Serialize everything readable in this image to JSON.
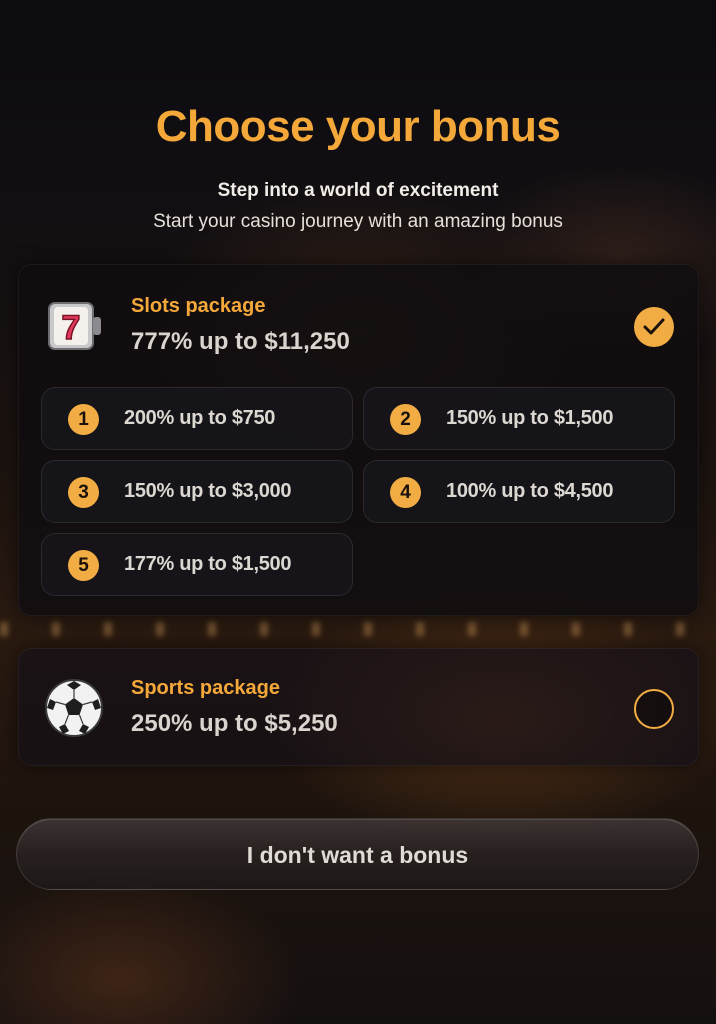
{
  "header": {
    "title": "Choose your bonus",
    "subtitle": "Step into a world of excitement",
    "tagline": "Start your casino journey with an amazing bonus"
  },
  "slots_package": {
    "icon": "slot-machine-777-icon",
    "name": "Slots package",
    "value": "777% up to $11,250",
    "selected": true,
    "options": [
      {
        "number": "1",
        "label": "200% up to $750"
      },
      {
        "number": "2",
        "label": "150% up to $1,500"
      },
      {
        "number": "3",
        "label": "150% up to $3,000"
      },
      {
        "number": "4",
        "label": "100% up to $4,500"
      },
      {
        "number": "5",
        "label": "177% up to $1,500"
      }
    ]
  },
  "sports_package": {
    "icon": "soccer-ball-icon",
    "name": "Sports package",
    "value": "250% up to $5,250",
    "selected": false
  },
  "no_bonus_button": {
    "label": "I don't want a bonus"
  },
  "colors": {
    "accent": "#f5a83a",
    "check": "#f2ac44",
    "text": "#dcd7d1"
  }
}
